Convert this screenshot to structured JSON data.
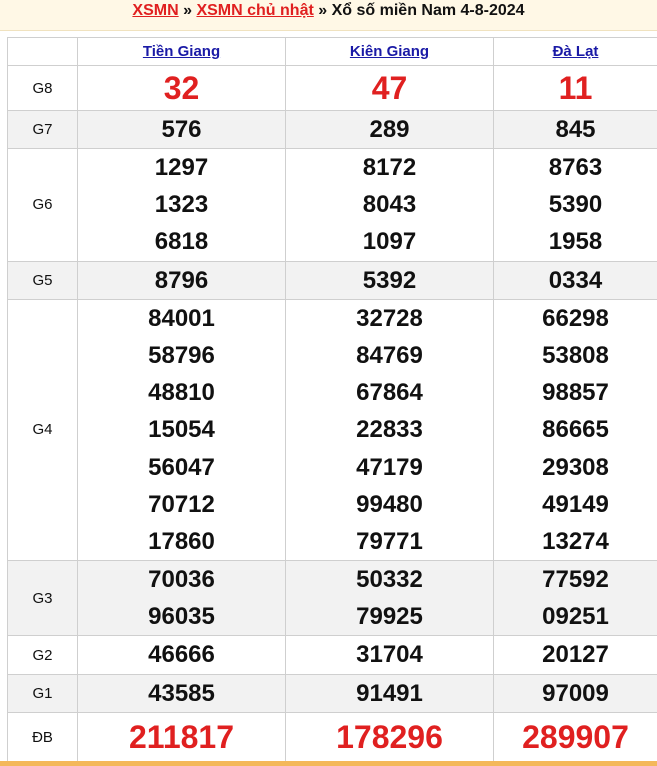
{
  "breadcrumb": {
    "link1": "XSMN",
    "sep1": "»",
    "link2": "XSMN chủ nhật",
    "sep2": "»",
    "current": "Xổ số miền Nam 4-8-2024"
  },
  "provinces": [
    "Tiền Giang",
    "Kiên Giang",
    "Đà Lạt"
  ],
  "prizes": [
    {
      "label": "G8",
      "values": [
        [
          "32"
        ],
        [
          "47"
        ],
        [
          "11"
        ]
      ]
    },
    {
      "label": "G7",
      "values": [
        [
          "576"
        ],
        [
          "289"
        ],
        [
          "845"
        ]
      ]
    },
    {
      "label": "G6",
      "values": [
        [
          "1297",
          "1323",
          "6818"
        ],
        [
          "8172",
          "8043",
          "1097"
        ],
        [
          "8763",
          "5390",
          "1958"
        ]
      ]
    },
    {
      "label": "G5",
      "values": [
        [
          "8796"
        ],
        [
          "5392"
        ],
        [
          "0334"
        ]
      ]
    },
    {
      "label": "G4",
      "values": [
        [
          "84001",
          "58796",
          "48810",
          "15054",
          "56047",
          "70712",
          "17860"
        ],
        [
          "32728",
          "84769",
          "67864",
          "22833",
          "47179",
          "99480",
          "79771"
        ],
        [
          "66298",
          "53808",
          "98857",
          "86665",
          "29308",
          "49149",
          "13274"
        ]
      ]
    },
    {
      "label": "G3",
      "values": [
        [
          "70036",
          "96035"
        ],
        [
          "50332",
          "79925"
        ],
        [
          "77592",
          "09251"
        ]
      ]
    },
    {
      "label": "G2",
      "values": [
        [
          "46666"
        ],
        [
          "31704"
        ],
        [
          "20127"
        ]
      ]
    },
    {
      "label": "G1",
      "values": [
        [
          "43585"
        ],
        [
          "91491"
        ],
        [
          "97009"
        ]
      ]
    },
    {
      "label": "ĐB",
      "values": [
        [
          "211817"
        ],
        [
          "178296"
        ],
        [
          "289907"
        ]
      ]
    }
  ],
  "colors": {
    "accent_red": "#e02020",
    "link_blue": "#1a1aa6",
    "row_alt": "#f2f2f2",
    "bar_orange": "#f4b85a"
  }
}
